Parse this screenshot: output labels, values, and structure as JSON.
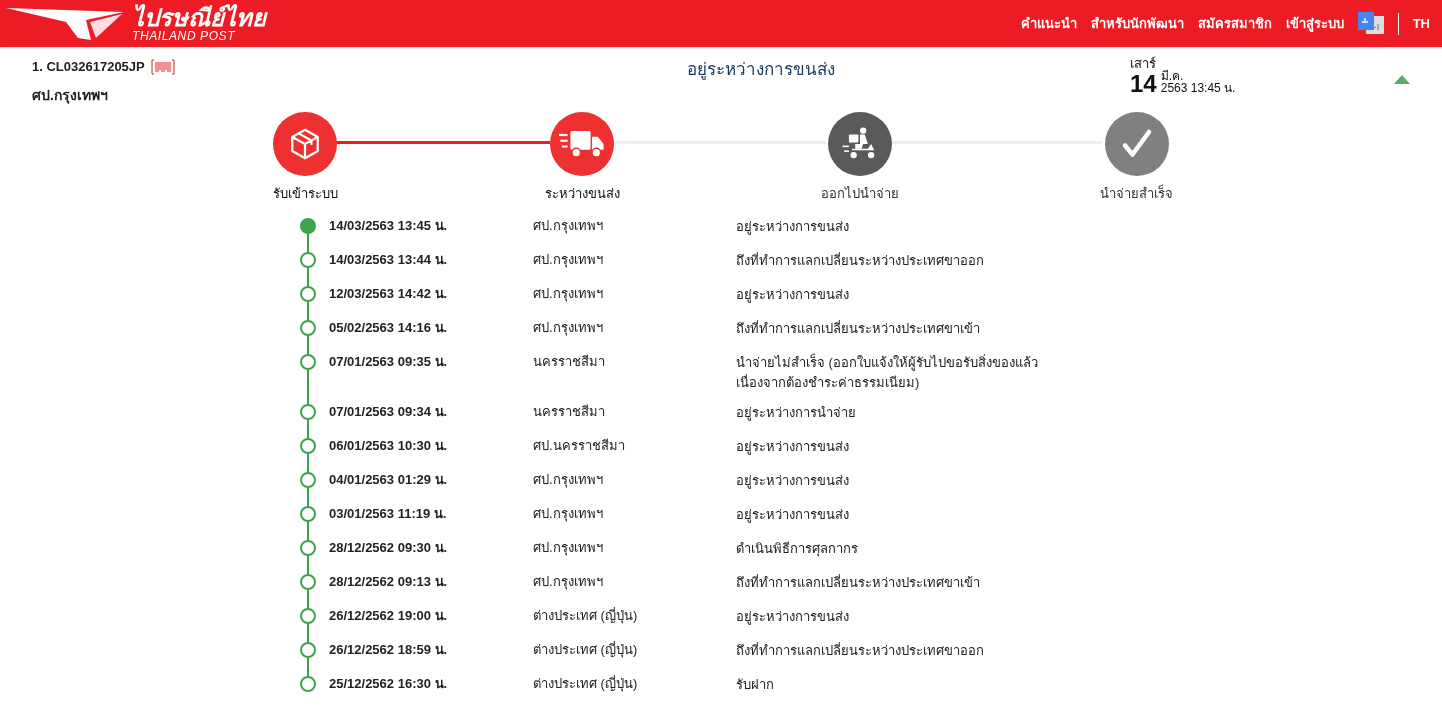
{
  "header": {
    "logo_thai": "ไปรษณีย์ไทย",
    "logo_english": "THAILAND POST",
    "nav": [
      "คำแนะนำ",
      "สำหรับนักพัฒนา",
      "สมัครสมาชิก",
      "เข้าสู่ระบบ"
    ],
    "language": "TH"
  },
  "parcel": {
    "number": "1. CL032617205JP",
    "location": "ศป.กรุงเทพฯ",
    "status": "อยู่ระหว่างการขนส่ง",
    "weekday": "เสาร์",
    "day": "14",
    "month": "มี.ค.",
    "year_time": "2563 13:45 น.",
    "expanded": true
  },
  "steps": [
    {
      "label": "รับเข้าระบบ",
      "kind": "box",
      "reached": true
    },
    {
      "label": "ระหว่างขนส่ง",
      "kind": "truck",
      "reached": true
    },
    {
      "label": "ออกไปนำจ่าย",
      "kind": "scooter",
      "reached": false,
      "color": "#5a5a5a"
    },
    {
      "label": "นำจ่ายสำเร็จ",
      "kind": "check",
      "reached": false,
      "color": "#808080"
    }
  ],
  "events": [
    {
      "time": "14/03/2563 13:45 น.",
      "location": "ศป.กรุงเทพฯ",
      "description": "อยู่ระหว่างการขนส่ง",
      "selected": true
    },
    {
      "time": "14/03/2563 13:44 น.",
      "location": "ศป.กรุงเทพฯ",
      "description": "ถึงที่ทำการแลกเปลี่ยนระหว่างประเทศขาออก",
      "selected": false
    },
    {
      "time": "12/03/2563 14:42 น.",
      "location": "ศป.กรุงเทพฯ",
      "description": "อยู่ระหว่างการขนส่ง",
      "selected": false
    },
    {
      "time": "05/02/2563 14:16 น.",
      "location": "ศป.กรุงเทพฯ",
      "description": "ถึงที่ทำการแลกเปลี่ยนระหว่างประเทศขาเข้า",
      "selected": false
    },
    {
      "time": "07/01/2563 09:35 น.",
      "location": "นครราชสีมา",
      "description": "นำจ่ายไม่สำเร็จ (ออกใบแจ้งให้ผู้รับไปขอรับสิ่งของแล้ว เนื่องจากต้องชำระค่าธรรมเนียม)",
      "selected": false
    },
    {
      "time": "07/01/2563 09:34 น.",
      "location": "นครราชสีมา",
      "description": "อยู่ระหว่างการนำจ่าย",
      "selected": false
    },
    {
      "time": "06/01/2563 10:30 น.",
      "location": "ศป.นครราชสีมา",
      "description": "อยู่ระหว่างการขนส่ง",
      "selected": false
    },
    {
      "time": "04/01/2563 01:29 น.",
      "location": "ศป.กรุงเทพฯ",
      "description": "อยู่ระหว่างการขนส่ง",
      "selected": false
    },
    {
      "time": "03/01/2563 11:19 น.",
      "location": "ศป.กรุงเทพฯ",
      "description": "อยู่ระหว่างการขนส่ง",
      "selected": false
    },
    {
      "time": "28/12/2562 09:30 น.",
      "location": "ศป.กรุงเทพฯ",
      "description": "ดำเนินพิธีการศุลกากร",
      "selected": false
    },
    {
      "time": "28/12/2562 09:13 น.",
      "location": "ศป.กรุงเทพฯ",
      "description": "ถึงที่ทำการแลกเปลี่ยนระหว่างประเทศขาเข้า",
      "selected": false
    },
    {
      "time": "26/12/2562 19:00 น.",
      "location": "ต่างประเทศ (ญี่ปุ่น)",
      "description": "อยู่ระหว่างการขนส่ง",
      "selected": false
    },
    {
      "time": "26/12/2562 18:59 น.",
      "location": "ต่างประเทศ (ญี่ปุ่น)",
      "description": "ถึงที่ทำการแลกเปลี่ยนระหว่างประเทศขาออก",
      "selected": false
    },
    {
      "time": "25/12/2562 16:30 น.",
      "location": "ต่างประเทศ (ญี่ปุ่น)",
      "description": "รับฝาก",
      "selected": false
    }
  ]
}
